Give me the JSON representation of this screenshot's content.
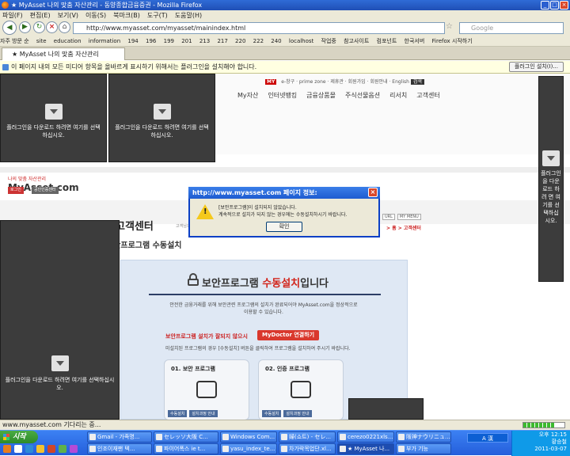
{
  "window": {
    "title": "★ MyAsset 나의 맞춤 자산관리 - 동양종합금융증권 - Mozilla Firefox"
  },
  "menu": [
    "파일(F)",
    "편집(E)",
    "보기(V)",
    "이동(S)",
    "북마크(B)",
    "도구(T)",
    "도움말(H)"
  ],
  "nav": {
    "url": "http://www.myasset.com/myasset/mainindex.html",
    "search_placeholder": "Google"
  },
  "bookmarks": [
    "자주 방문 순",
    "site",
    "education",
    "information",
    "194",
    "196",
    "199",
    "201",
    "213",
    "217",
    "220",
    "222",
    "240",
    "localhost",
    "작업중",
    "참고사이트",
    "컴포넌트",
    "한국서버",
    "Firefox 시작하기"
  ],
  "tab": {
    "label": "★ MyAsset 나의 맞춤 자산관리"
  },
  "notification": {
    "text": "이 페이지 내의 모든 미디어 항목을 올바르게 표시하기 위해서는 플러그인을 설치해야 합니다.",
    "button": "플러그인 설치(I)..."
  },
  "plugin": {
    "text_a": "플러그인을 다운로드 하려면 여기를 선택 하십시오.",
    "text_b": "플러그인을 다운로드 하려면 여기를 선택하십시오.",
    "text_side": "플러그인 을 다운 로드 하려 면 여 기를 선 택하십 시오."
  },
  "site": {
    "topnav": [
      "MY",
      "e-창구",
      "prime zone",
      "제휴관",
      "회원가입",
      "회원안내",
      "English"
    ],
    "topnav_btn": "검색",
    "mainnav": [
      "My자산",
      "인터넷뱅킹",
      "금융상품몰",
      "주식선물옵션",
      "리서치",
      "고객센터"
    ],
    "logo": "MyAsset.com",
    "logo_slogan": "나의 맞춤 자산관리",
    "btn_login": "로그인",
    "btn_cert": "공인인증센터",
    "page_title": "고객센터",
    "page_caption": "고객님의 소중",
    "sub_title": "보안프로그램 수동설치",
    "breadcrumb": "> 홈 > 고객센터",
    "small_links": [
      "URL",
      "MY MENU"
    ],
    "panel_head_a": "보안프로그램 ",
    "panel_head_b": "수동설치",
    "panel_head_c": "입니다",
    "panel_desc": "안전한 금융거래를 위해 보안관련 프로그램의 설치가 완료되어야 MyAsset.com을 정상적으로 이용할 수 있습니다.",
    "panel_warn": "보안프로그램 설치가 잘되지 않으시",
    "mydoctor": "MyDoctor 연결하기",
    "panel_note": "미설치된 프로그램의 경우 [수동설치] 버튼을 클릭하여 프로그램을 설치하여 주시기 바랍니다.",
    "card1_title": "01. 보안 프로그램",
    "card2_title": "02. 인증 프로그램",
    "card_btn1": "수동설치",
    "card_btn2": "설치과정 안내"
  },
  "dialog": {
    "title": "http://www.myasset.com 페이지 정보:",
    "line1": "[보안프로그램]이 설치되지 않았습니다.",
    "line2": "계속적으로 설치가 되지 않는 경우에는 수동설치하시기 바랍니다.",
    "ok": "확인"
  },
  "status": {
    "text": "www.myasset.com 기다리는 중...",
    "progress": 0.75
  },
  "taskbar": {
    "start": "시작",
    "row1": [
      "Gmail - 가족명...",
      "セレッソ大阪 C...",
      "Windows Com...",
      "婦(쇼트) - セレ...",
      "cerezo0221xls...",
      "阪神ナウリニュ..."
    ],
    "row2": [
      "인조이재팬 텍...",
      "파이어폭스 ie t...",
      "yasu_index_te...",
      "차가락목업단.xl...",
      "★ MyAsset 나...",
      "부가 기능"
    ],
    "time": "오후 12:15",
    "user": "황승철",
    "date": "2011-03-07"
  }
}
